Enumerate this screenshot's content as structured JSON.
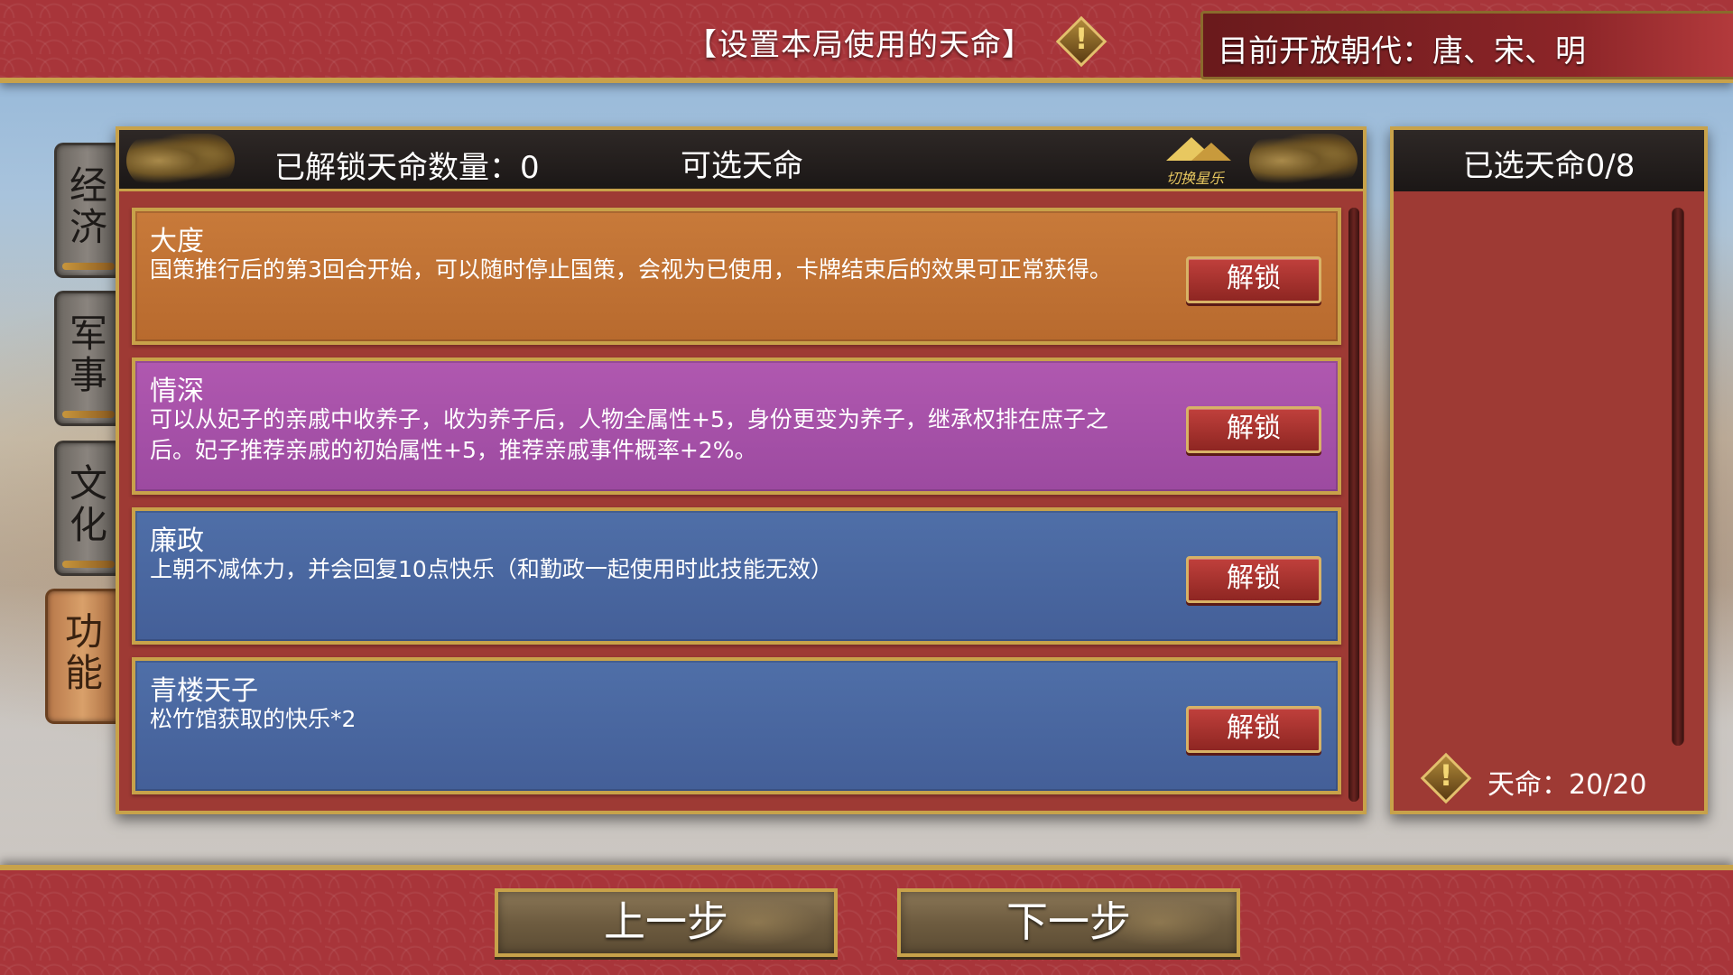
{
  "top_bar": {
    "title": "【设置本局使用的天命】",
    "warning_icon": "exclamation-diamond",
    "dynasty_info": "目前开放朝代：唐、宋、明"
  },
  "side_tabs": [
    {
      "label": "经济",
      "active": false
    },
    {
      "label": "军事",
      "active": false
    },
    {
      "label": "文化",
      "active": false
    },
    {
      "label": "功能",
      "active": true
    }
  ],
  "main_panel": {
    "unlocked_count": "已解锁天命数量：0",
    "title": "可选天命",
    "switch_label": "切换星乐",
    "cards": [
      {
        "name": "大度",
        "description": "国策推行后的第3回合开始，可以随时停止国策，会视为已使用，卡牌结束后的效果可正常获得。",
        "button": "解锁",
        "color": "#c87a3a"
      },
      {
        "name": "情深",
        "description": "可以从妃子的亲戚中收养子，收为养子后，人物全属性+5，身份更变为养子，继承权排在庶子之后。妃子推荐亲戚的初始属性+5，推荐亲戚事件概率+2%。",
        "button": "解锁",
        "color": "#b058b0"
      },
      {
        "name": "廉政",
        "description": "上朝不减体力，并会回复10点快乐（和勤政一起使用时此技能无效）",
        "button": "解锁",
        "color": "#4f6fa8"
      },
      {
        "name": "青楼天子",
        "description": "松竹馆获取的快乐*2",
        "button": "解锁",
        "color": "#4f6fa8"
      }
    ]
  },
  "right_panel": {
    "selected_count": "已选天命0/8",
    "mandate": "天命：20/20",
    "mandate_icon": "exclamation-diamond"
  },
  "bottom_bar": {
    "prev_button": "上一步",
    "next_button": "下一步"
  },
  "colors": {
    "gold": "#c8a24a",
    "panel_red": "#9e3a34",
    "unlock_button": "#b03630"
  }
}
